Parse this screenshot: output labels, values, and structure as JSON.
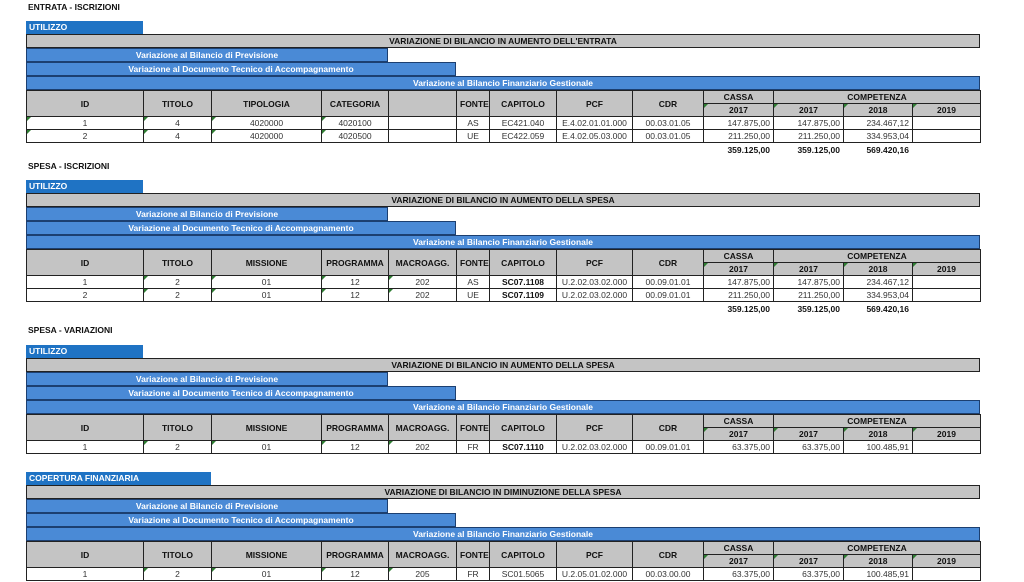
{
  "columns_entrata": [
    "ID",
    "TITOLO",
    "TIPOLOGIA",
    "CATEGORIA",
    "",
    "FONTE",
    "CAPITOLO",
    "PCF",
    "CDR"
  ],
  "columns_spesa": [
    "ID",
    "TITOLO",
    "MISSIONE",
    "PROGRAMMA",
    "MACROAGG.",
    "FONTE",
    "CAPITOLO",
    "PCF",
    "CDR"
  ],
  "header_groups": {
    "cassa": "CASSA",
    "competenza": "COMPETENZA",
    "years": [
      "2017",
      "2017",
      "2018",
      "2019"
    ]
  },
  "bars": {
    "previsione": "Variazione al Bilancio di Previsione",
    "documento_tecnico": "Variazione al Documento Tecnico di Accompagnamento",
    "gestionale": "Variazione al Bilancio Finanziario Gestionale"
  },
  "sections": [
    {
      "title": "ENTRATA - ISCRIZIONI",
      "tag": "UTILIZZO",
      "gray_title": "VARIAZIONE DI BILANCIO IN AUMENTO DELL'ENTRATA",
      "rows": [
        [
          "1",
          "4",
          "4020000",
          "4020100",
          "",
          "AS",
          "EC421.040",
          "E.4.02.01.01.000",
          "00.03.01.05",
          "147.875,00",
          "147.875,00",
          "234.467,12",
          ""
        ],
        [
          "2",
          "4",
          "4020000",
          "4020500",
          "",
          "UE",
          "EC422.059",
          "E.4.02.05.03.000",
          "00.03.01.05",
          "211.250,00",
          "211.250,00",
          "334.953,04",
          ""
        ]
      ],
      "totals": [
        "359.125,00",
        "359.125,00",
        "569.420,16"
      ]
    },
    {
      "title": "SPESA - ISCRIZIONI",
      "tag": "UTILIZZO",
      "gray_title": "VARIAZIONE DI BILANCIO IN AUMENTO DELLA SPESA",
      "rows": [
        [
          "1",
          "2",
          "01",
          "12",
          "202",
          "AS",
          "SC07.1108",
          "U.2.02.03.02.000",
          "00.09.01.01",
          "147.875,00",
          "147.875,00",
          "234.467,12",
          ""
        ],
        [
          "2",
          "2",
          "01",
          "12",
          "202",
          "UE",
          "SC07.1109",
          "U.2.02.03.02.000",
          "00.09.01.01",
          "211.250,00",
          "211.250,00",
          "334.953,04",
          ""
        ]
      ],
      "totals": [
        "359.125,00",
        "359.125,00",
        "569.420,16"
      ]
    },
    {
      "title": "SPESA - VARIAZIONI",
      "tag": "UTILIZZO",
      "gray_title": "VARIAZIONE DI BILANCIO IN AUMENTO DELLA SPESA",
      "rows": [
        [
          "1",
          "2",
          "01",
          "12",
          "202",
          "FR",
          "SC07.1110",
          "U.2.02.03.02.000",
          "00.09.01.01",
          "63.375,00",
          "63.375,00",
          "100.485,91",
          ""
        ]
      ]
    },
    {
      "title": "",
      "tag": "COPERTURA FINANZIARIA",
      "gray_title": "VARIAZIONE DI BILANCIO IN DIMINUZIONE DELLA SPESA",
      "rows": [
        [
          "1",
          "2",
          "01",
          "12",
          "205",
          "FR",
          "SC01.5065",
          "U.2.05.01.02.000",
          "00.03.00.00",
          "63.375,00",
          "63.375,00",
          "100.485,91",
          ""
        ]
      ]
    }
  ]
}
